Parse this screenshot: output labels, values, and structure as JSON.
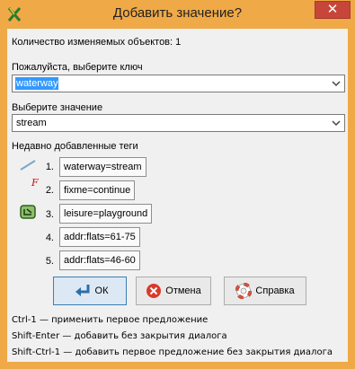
{
  "window": {
    "title": "Добавить значение?",
    "close_glyph": "✕"
  },
  "count_line": "Количество изменяемых объектов: 1",
  "key": {
    "label": "Пожалуйста, выберите ключ",
    "value": "waterway"
  },
  "value": {
    "label": "Выберите значение",
    "value": "stream"
  },
  "recent": {
    "label": "Недавно добавленные теги",
    "items": [
      {
        "num": "1.",
        "text": "waterway=stream",
        "icon": "waterway-line-icon"
      },
      {
        "num": "2.",
        "text": "fixme=continue",
        "icon": "fixme-icon"
      },
      {
        "num": "3.",
        "text": "leisure=playground",
        "icon": "playground-icon"
      },
      {
        "num": "4.",
        "text": "addr:flats=61-75",
        "icon": ""
      },
      {
        "num": "5.",
        "text": "addr:flats=46-60",
        "icon": ""
      }
    ]
  },
  "buttons": {
    "ok": "ОК",
    "cancel": "Отмена",
    "help": "Справка"
  },
  "hints": [
    {
      "keys": "Ctrl-1",
      "text": " — применить первое предложение"
    },
    {
      "keys": "Shift-Enter",
      "text": " — добавить без закрытия диалога"
    },
    {
      "keys": "Shift-Ctrl-1",
      "text": " — добавить первое предложение без закрытия диалога"
    }
  ],
  "colors": {
    "frame": "#efa946",
    "close": "#c7463a",
    "selection": "#3399ff"
  }
}
